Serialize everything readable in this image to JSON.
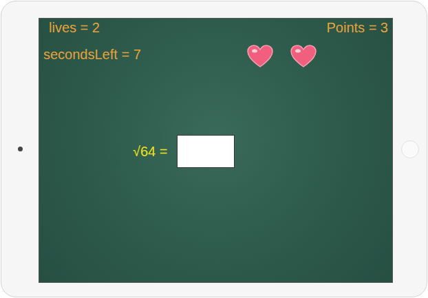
{
  "hud": {
    "lives": "lives = 2",
    "points": "Points = 3",
    "secondsLeft": "secondsLeft = 7"
  },
  "hearts": [
    {
      "filled": true
    },
    {
      "filled": true
    }
  ],
  "question": {
    "prompt": "√64 =",
    "answer": ""
  }
}
